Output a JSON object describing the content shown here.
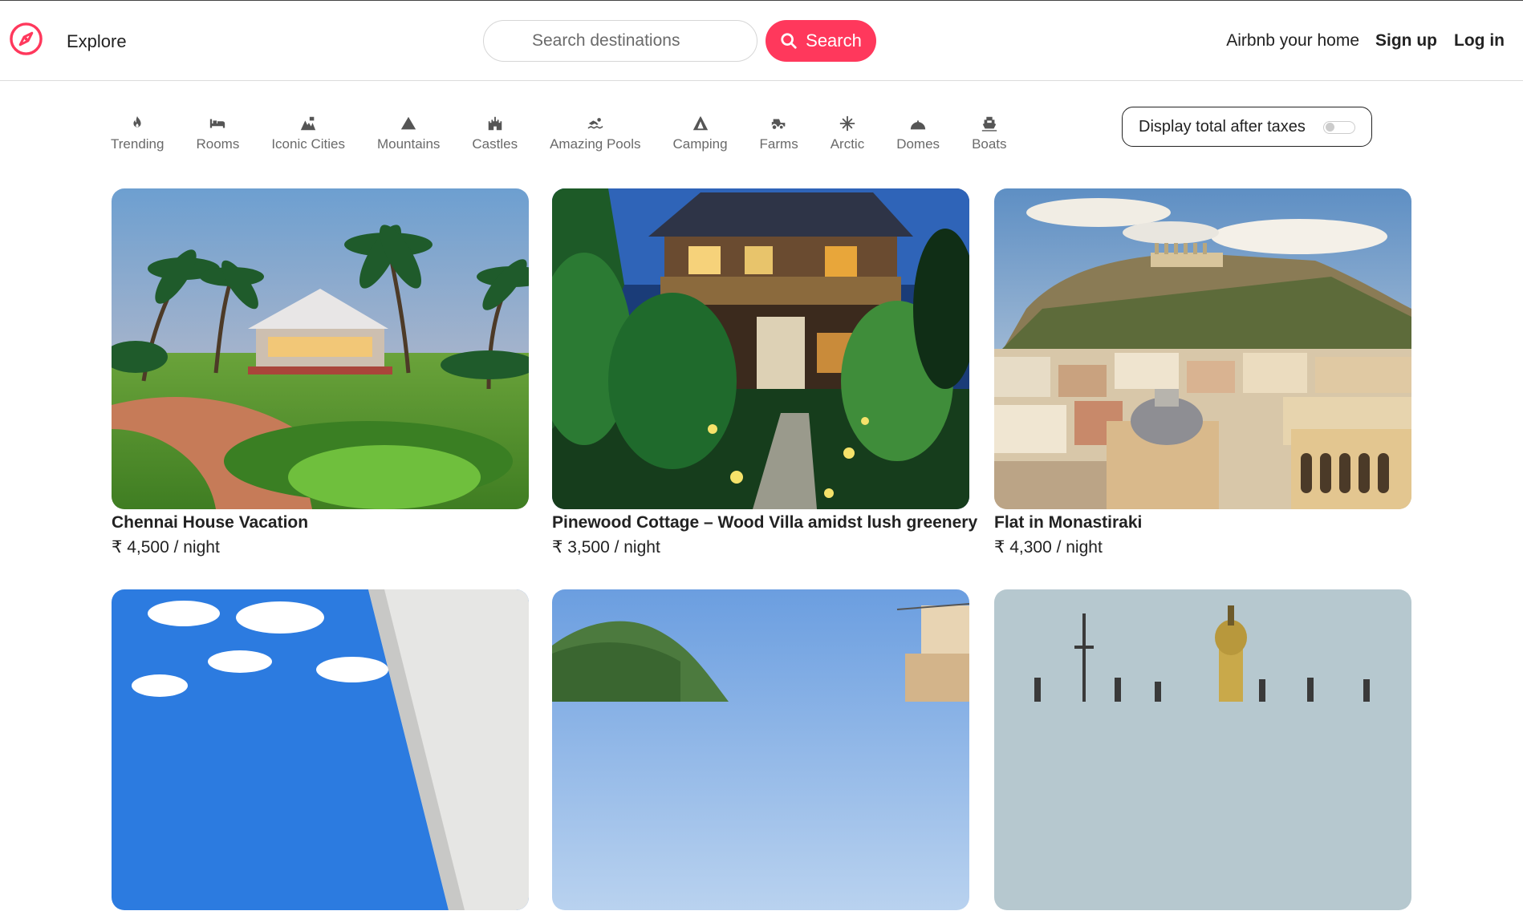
{
  "header": {
    "logo_icon": "compass-icon",
    "explore_label": "Explore",
    "search_placeholder": "Search destinations",
    "search_button_label": "Search",
    "host_label": "Airbnb your home",
    "signup_label": "Sign up",
    "login_label": "Log in",
    "accent_color": "#ff385c"
  },
  "categories": [
    {
      "label": "Trending",
      "icon": "flame-icon"
    },
    {
      "label": "Rooms",
      "icon": "bed-icon"
    },
    {
      "label": "Iconic Cities",
      "icon": "city-icon"
    },
    {
      "label": "Mountains",
      "icon": "mountain-icon"
    },
    {
      "label": "Castles",
      "icon": "castle-icon"
    },
    {
      "label": "Amazing Pools",
      "icon": "swimmer-icon"
    },
    {
      "label": "Camping",
      "icon": "tent-icon"
    },
    {
      "label": "Farms",
      "icon": "tractor-icon"
    },
    {
      "label": "Arctic",
      "icon": "snowflake-icon"
    },
    {
      "label": "Domes",
      "icon": "dome-icon"
    },
    {
      "label": "Boats",
      "icon": "boat-icon"
    }
  ],
  "tax_toggle": {
    "label": "Display total after taxes",
    "enabled": false
  },
  "listings": [
    {
      "title": "Chennai House Vacation",
      "price": "₹ 4,500 / night"
    },
    {
      "title": "Pinewood Cottage – Wood Villa amidst lush greenery",
      "price": "₹ 3,500 / night"
    },
    {
      "title": "Flat in Monastiraki",
      "price": "₹ 4,300 / night"
    },
    {
      "title": "",
      "price": ""
    },
    {
      "title": "",
      "price": ""
    },
    {
      "title": "",
      "price": ""
    }
  ]
}
